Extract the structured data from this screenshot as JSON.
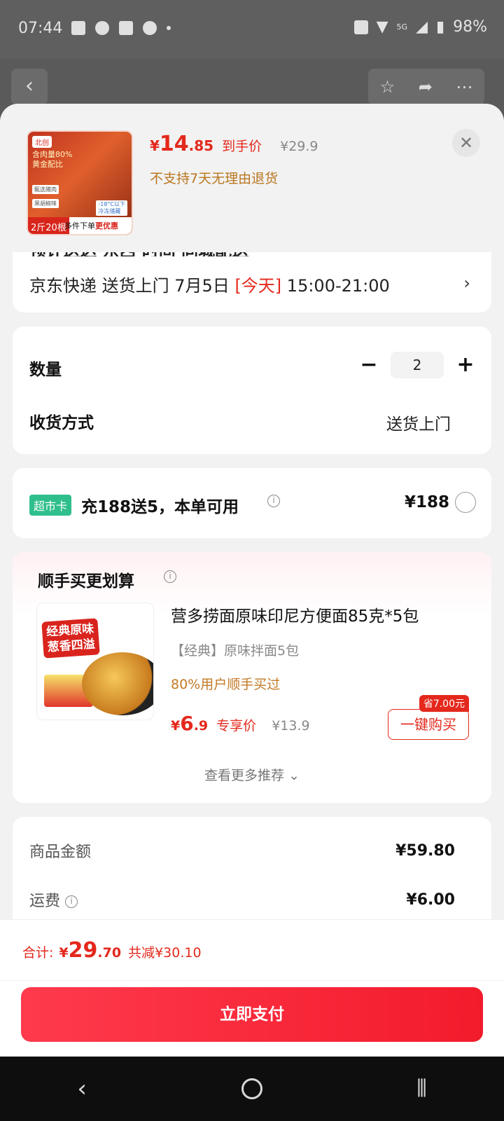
{
  "status_bar": {
    "time": "07:44",
    "battery": "98%",
    "network": "5G"
  },
  "product": {
    "price_currency": "¥",
    "price_integer": "14",
    "price_decimal": ".85",
    "price_tag": "到手价",
    "original_price": "¥29.9",
    "return_policy": "不支持7天无理由退货",
    "thumb": {
      "logo": "北创",
      "headline": "含肉量80%\n黄金配比",
      "chip1": "甄选猪肉",
      "chip2": "黑胡椒味",
      "temp": "-18°C以下\n冷冻储藏",
      "qty": "2斤20根",
      "promo_prefix": "多件下单",
      "promo_highlight": "更优惠"
    }
  },
  "delivery": {
    "cut_text": "预计送达 东西 时间 同城配送",
    "carrier": "京东快递 送货上门 7月5日 ",
    "today": "[今天]",
    "time_slot": " 15:00-21:00"
  },
  "order": {
    "quantity_label": "数量",
    "quantity": "2",
    "shipping_label": "收货方式",
    "shipping_value": "送货上门"
  },
  "member_card": {
    "badge": "超市卡",
    "text": "充188送5，本单可用",
    "price": "¥188"
  },
  "addon": {
    "section_title": "顺手买更划算",
    "image_badge": "经典原味\n葱香四溢",
    "name": "营多捞面原味印尼方便面85克*5包",
    "spec": "【经典】原味拌面5包",
    "rate": "80%用户顺手买过",
    "price_currency": "¥",
    "price_integer": "6",
    "price_decimal": ".9",
    "price_tag": "专享价",
    "original_price": "¥13.9",
    "save_tag": "省7.00元",
    "buy_label": "一键购买",
    "more_label": "查看更多推荐"
  },
  "amounts": [
    {
      "label": "商品金额",
      "value": "¥59.80"
    },
    {
      "label": "运费",
      "value": "¥6.00"
    }
  ],
  "footer": {
    "total_label": "合计:",
    "total_currency": "¥",
    "total_integer": "29",
    "total_decimal": ".70",
    "saved": "共减¥30.10",
    "pay_label": "立即支付"
  },
  "colors": {
    "accent": "#e4281c",
    "member_green": "#2fbf8c",
    "promo_gold": "#c27a25"
  }
}
